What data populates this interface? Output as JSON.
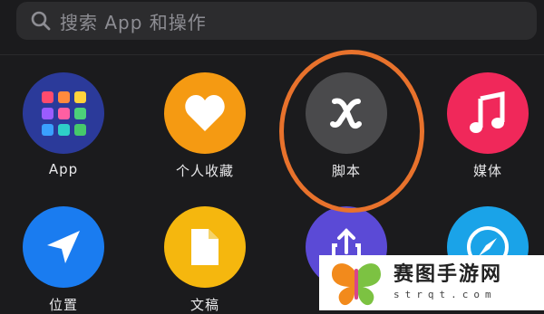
{
  "search": {
    "placeholder": "搜索 App 和操作"
  },
  "grid": {
    "items": [
      {
        "label": "App",
        "icon": "app-grid-icon",
        "color": "#2b3a9a"
      },
      {
        "label": "个人收藏",
        "icon": "heart-icon",
        "color": "#f59a12"
      },
      {
        "label": "脚本",
        "icon": "script-x-icon",
        "color": "#4a4a4c"
      },
      {
        "label": "媒体",
        "icon": "music-note-icon",
        "color": "#f0285a"
      },
      {
        "label": "位置",
        "icon": "location-arrow-icon",
        "color": "#1a7cf0"
      },
      {
        "label": "文稿",
        "icon": "document-icon",
        "color": "#f5b70e"
      },
      {
        "label": "",
        "icon": "share-icon",
        "color": "#5b4ad6"
      },
      {
        "label": "",
        "icon": "safari-icon",
        "color": "#1aa3e8"
      }
    ]
  },
  "accent": {
    "highlight": "#e8722c"
  },
  "watermark": {
    "title": "赛图手游网",
    "subtitle": "strqt.com"
  }
}
